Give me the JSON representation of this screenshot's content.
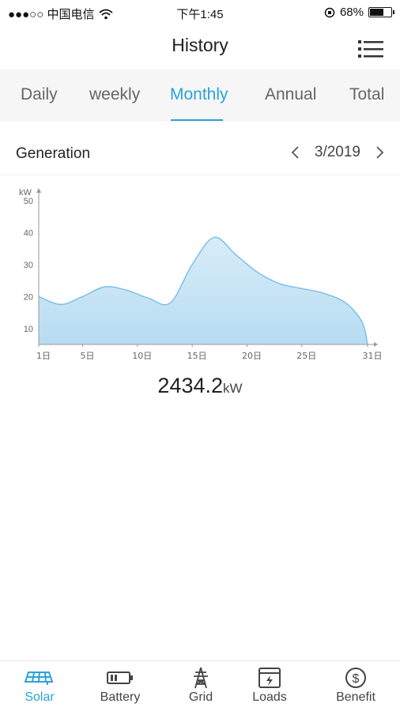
{
  "status_bar": {
    "carrier": "●●●○○ 中国电信",
    "time": "下午1:45",
    "battery_percent": "68%",
    "battery_level": 0.68
  },
  "header": {
    "title": "History"
  },
  "tabs": [
    {
      "label": "Daily",
      "active": false
    },
    {
      "label": "weekly",
      "active": false
    },
    {
      "label": "Monthly",
      "active": true
    },
    {
      "label": "Annual",
      "active": false
    },
    {
      "label": "Total",
      "active": false
    }
  ],
  "section": {
    "title": "Generation",
    "period": "3/2019"
  },
  "chart_data": {
    "type": "area",
    "ylabel": "kW",
    "ylim": [
      5,
      50
    ],
    "yticks": [
      50,
      40,
      30,
      20,
      10
    ],
    "xlim": [
      1,
      31
    ],
    "xtick_values": [
      1,
      5,
      10,
      15,
      20,
      25,
      31
    ],
    "xtick_labels": [
      "1日",
      "5日",
      "10日",
      "15日",
      "20日",
      "25日",
      "31日"
    ],
    "x": [
      1,
      3,
      5,
      7,
      9,
      11,
      13,
      15,
      17,
      19,
      21,
      23,
      25,
      27,
      29,
      30.5,
      31
    ],
    "values": [
      20,
      17.5,
      20,
      23,
      22,
      19.5,
      18,
      30,
      38.5,
      33,
      27.5,
      24,
      22.5,
      21,
      18,
      12,
      5
    ],
    "grid": false,
    "fill_color": "#cfe6f6",
    "line_color": "#7fc3ea"
  },
  "total": {
    "value": "2434.2",
    "unit": "kW"
  },
  "bottom_nav": [
    {
      "label": "Solar",
      "icon": "solar-panel-icon",
      "active": true
    },
    {
      "label": "Battery",
      "icon": "battery-icon",
      "active": false
    },
    {
      "label": "Grid",
      "icon": "power-tower-icon",
      "active": false
    },
    {
      "label": "Loads",
      "icon": "loads-icon",
      "active": false
    },
    {
      "label": "Benefit",
      "icon": "dollar-coin-icon",
      "active": false
    }
  ],
  "colors": {
    "accent": "#2aa3d8",
    "tab_background": "#f6f6f7"
  }
}
